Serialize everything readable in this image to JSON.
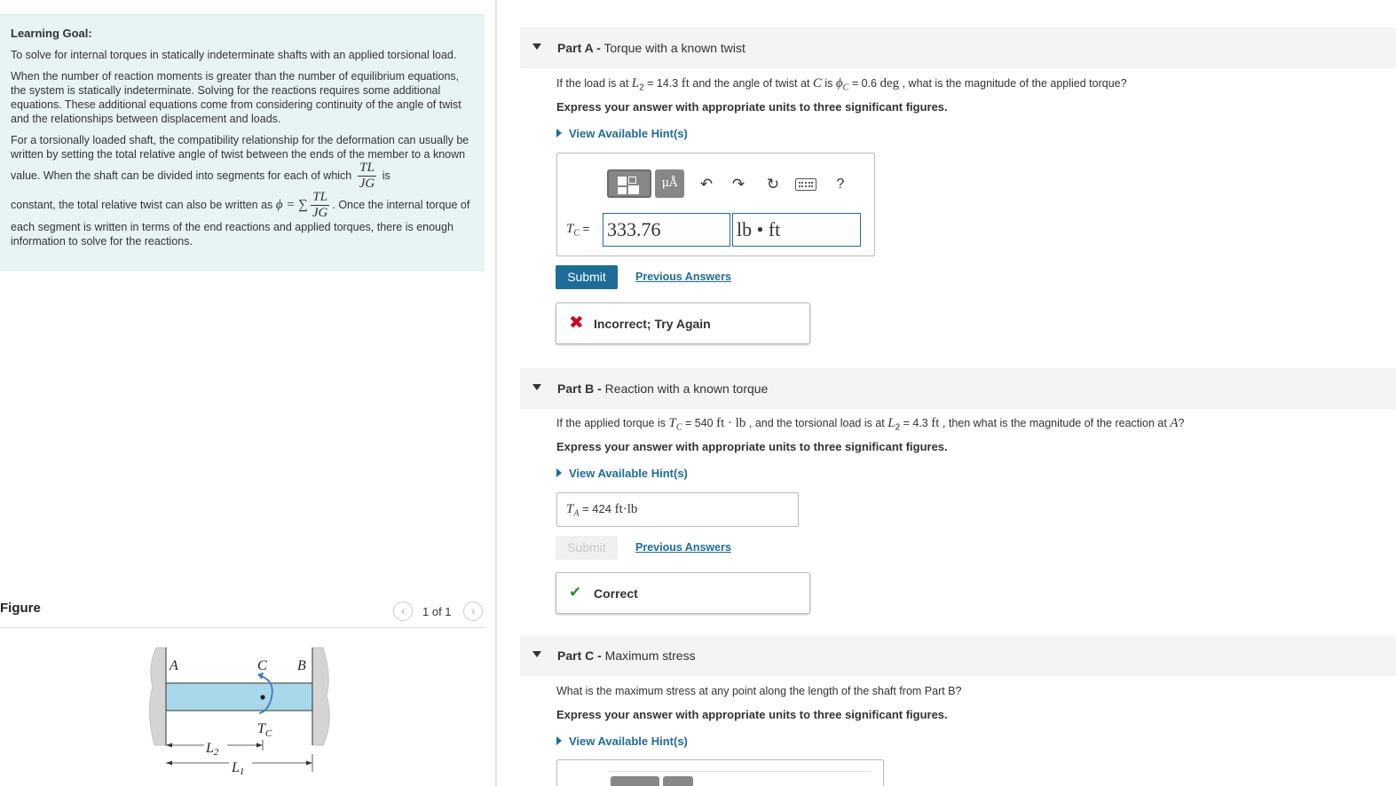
{
  "learning_goal": {
    "title": "Learning Goal:",
    "intro": "To solve for internal torques in statically indeterminate shafts with an applied torsional load.",
    "para1": "When the number of reaction moments is greater than the number of equilibrium equations, the system is statically indeterminate. Solving for the reactions requires some additional equations. These additional equations come from considering continuity of the angle of twist and the relationships between displacement and loads.",
    "para2_a": "For a torsionally loaded shaft, the compatibility relationship for the deformation can usually be written by setting the total relative angle of twist between the ends of the member to a known value. When the shaft can be divided into segments for each of which",
    "frac_num": "TL",
    "frac_den": "JG",
    "para2_b": "is",
    "para2_c": "constant, the total relative twist can also be written as",
    "phi_eq": "ϕ = ∑",
    "para2_d": ". Once the internal torque of each segment is written in terms of the end reactions and applied torques, there is enough information to solve for the reactions."
  },
  "figure": {
    "title": "Figure",
    "pager": "1 of 1",
    "prev_icon": "‹",
    "next_icon": "›",
    "labels": {
      "a": "A",
      "b": "B",
      "c": "C",
      "tc": "T",
      "tc_sub": "C",
      "l1": "L",
      "l1_sub": "1",
      "l2": "L",
      "l2_sub": "2"
    },
    "colors": {
      "shaft": "#a8d8ea",
      "wall": "#d4d4d4",
      "torque_arrow": "#3a7fc1"
    }
  },
  "part_a": {
    "label_bold": "Part A -",
    "label": " Torque with a known twist",
    "question": {
      "q1": "If the load is at ",
      "var_l2": "L",
      "var_l2_sub": "2",
      "q2": " = 14.3 ",
      "unit_ft": "ft",
      "q3": " and the angle of twist at ",
      "var_c": "C",
      "q4": " is ",
      "var_phi": "ϕ",
      "var_phi_sub": "C",
      "q5": " = 0.6 ",
      "unit_deg": "deg",
      "q6": " , what is the magnitude of the applied torque?"
    },
    "instruction": "Express your answer with appropriate units to three significant figures.",
    "hint": "View Available Hint(s)",
    "toolbar": {
      "units_label": "μÅ",
      "undo_icon": "↶",
      "redo_icon": "↷",
      "reset_icon": "↻",
      "help_label": "?"
    },
    "input_label_var": "T",
    "input_label_sub": "C",
    "input_label_eq": " =",
    "value": "333.76",
    "unit": "lb • ft",
    "submit": "Submit",
    "previous_answers": "Previous Answers",
    "feedback_icon": "✖",
    "feedback": "Incorrect; Try Again",
    "colors": {
      "incorrect": "#d0021b",
      "button": "#1e6c9a"
    }
  },
  "part_b": {
    "label_bold": "Part B -",
    "label": " Reaction with a known torque",
    "question": {
      "q1": "If the applied torque is ",
      "var_tc": "T",
      "var_tc_sub": "C",
      "q2": " = 540 ",
      "unit_ftlb": "ft · lb",
      "q3": " , and the torsional load is at ",
      "var_l2": "L",
      "var_l2_sub": "2",
      "q4": " = 4.3 ",
      "unit_ft": "ft",
      "q5": " , then what is the magnitude of the reaction at ",
      "var_a": "A",
      "q6": "?"
    },
    "instruction": "Express your answer with appropriate units to three significant figures.",
    "hint": "View Available Hint(s)",
    "answer_var": "T",
    "answer_sub": "A",
    "answer_eq": " =  424 ",
    "answer_unit": "ft·lb",
    "submit": "Submit",
    "previous_answers": "Previous Answers",
    "feedback_icon": "✔",
    "feedback": "Correct",
    "colors": {
      "correct": "#2e8b3a"
    }
  },
  "part_c": {
    "label_bold": "Part C -",
    "label": " Maximum stress",
    "question": "What is the maximum stress at any point along the length of the shaft from Part B?",
    "instruction": "Express your answer with appropriate units to three significant figures.",
    "hint": "View Available Hint(s)"
  }
}
